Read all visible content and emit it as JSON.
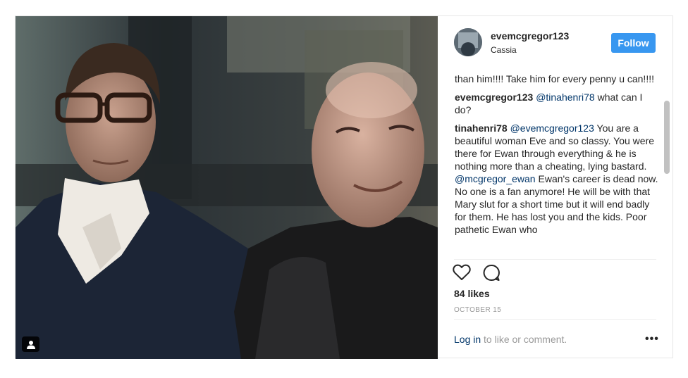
{
  "post": {
    "username": "evemcgregor123",
    "location": "Cassia",
    "follow_label": "Follow",
    "likes": "84 likes",
    "date": "OCTOBER 15"
  },
  "comments": [
    {
      "user": "",
      "text": "than him!!!! Take him for every penny u can!!!!"
    },
    {
      "user": "evemcgregor123",
      "mention": "@tinahenri78",
      "text": " what can I do?"
    },
    {
      "user": "tinahenri78",
      "mention": "@evemcgregor123",
      "text": " You are a beautiful woman Eve and so classy. You were there for Ewan through everything & he is nothing more than a cheating, lying bastard. ",
      "mention2": "@mcgregor_ewan",
      "text2": " Ewan's career is dead now. No one is a fan anymore! He will be with that Mary slut for a short time but it will end badly for them. He has lost you and the kids. Poor pathetic Ewan who"
    }
  ],
  "footer": {
    "login_link": "Log in",
    "login_rest": " to like or comment.",
    "more": "•••"
  },
  "icons": {
    "like": "heart-icon",
    "comment": "speech-bubble-icon",
    "tag": "user-tag-icon",
    "more": "more-options-icon"
  },
  "colors": {
    "follow_bg": "#3897f0",
    "mention": "#003569",
    "muted": "#999999"
  }
}
